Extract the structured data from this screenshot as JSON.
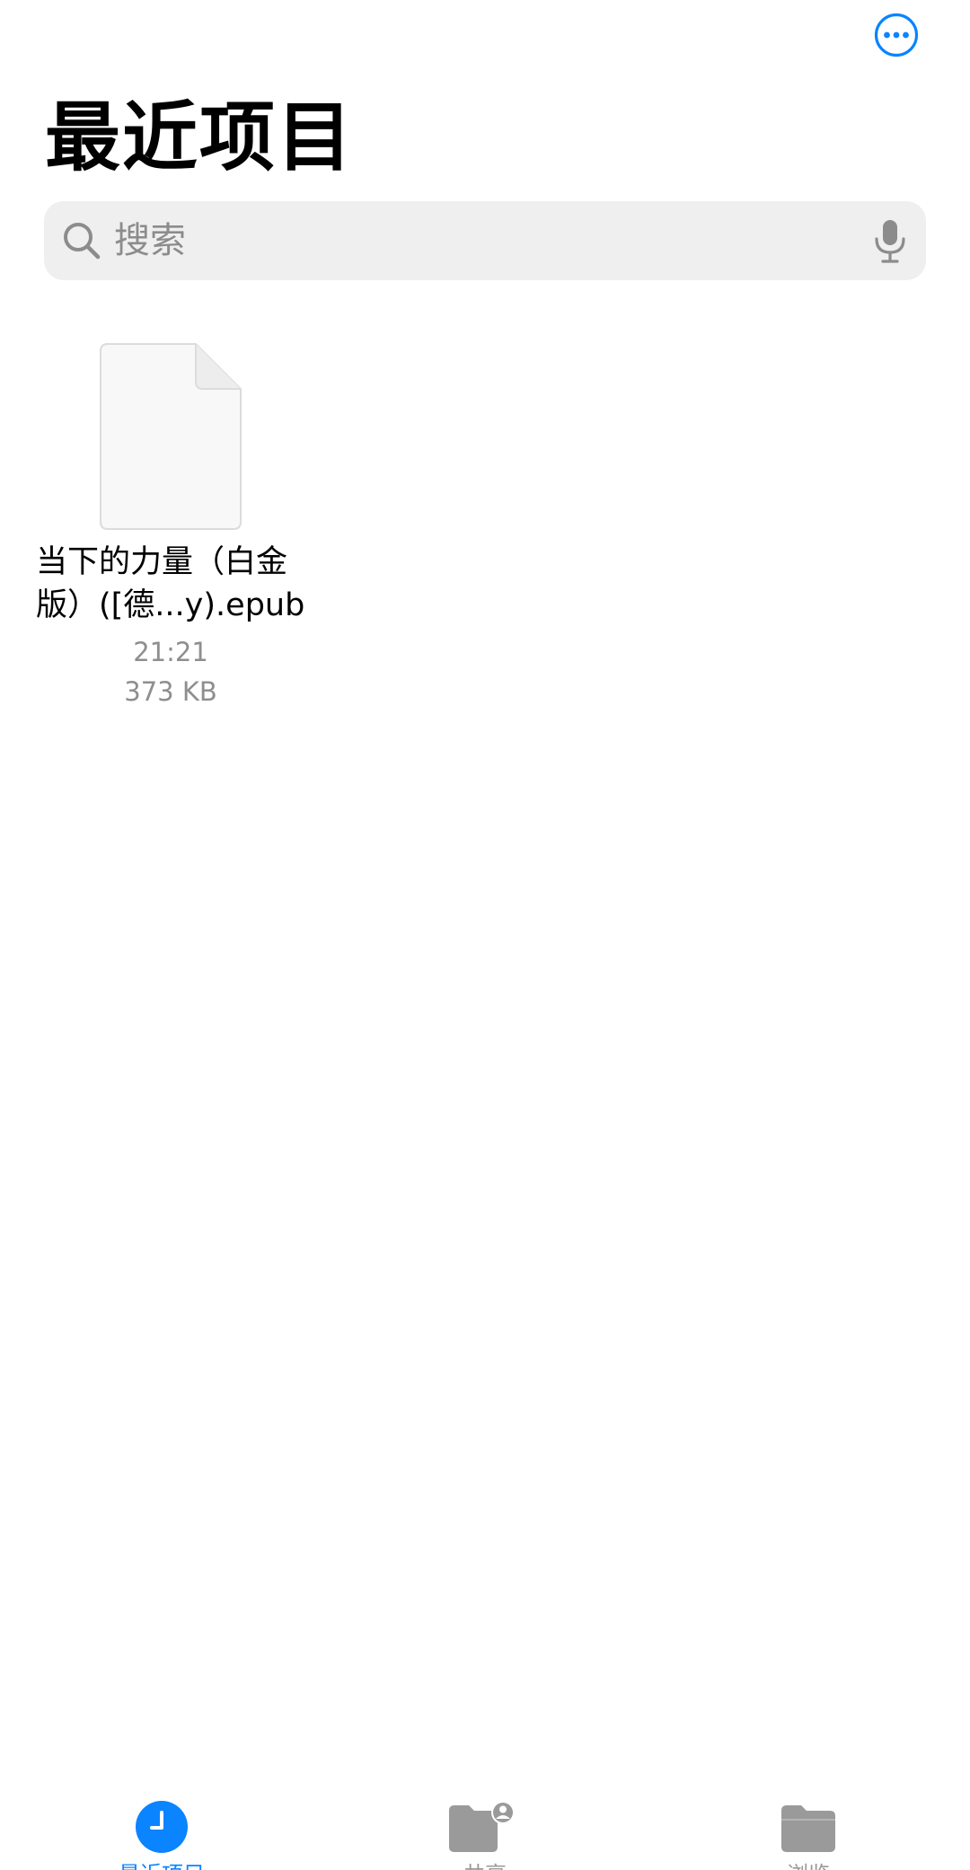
{
  "header": {
    "title": "最近项目",
    "more_icon": "ellipsis-circle-icon"
  },
  "search": {
    "placeholder": "搜索",
    "search_icon": "magnifying-glass-icon",
    "mic_icon": "microphone-icon"
  },
  "files": [
    {
      "name_line1": "当下的力量（白金",
      "name_line2": "版）([德...y).epub",
      "time": "21:21",
      "size": "373 KB",
      "thumb_icon": "document-icon"
    }
  ],
  "tabbar": {
    "tabs": [
      {
        "label": "最近项目",
        "icon": "clock-icon",
        "selected": true
      },
      {
        "label": "共享",
        "icon": "shared-folder-icon",
        "selected": false
      },
      {
        "label": "浏览",
        "icon": "folder-icon",
        "selected": false
      }
    ]
  },
  "colors": {
    "accent": "#0a84ff",
    "inactive_icon": "#9a9a9a",
    "secondary_text": "#8e8e8e",
    "search_bg": "#efefef"
  }
}
